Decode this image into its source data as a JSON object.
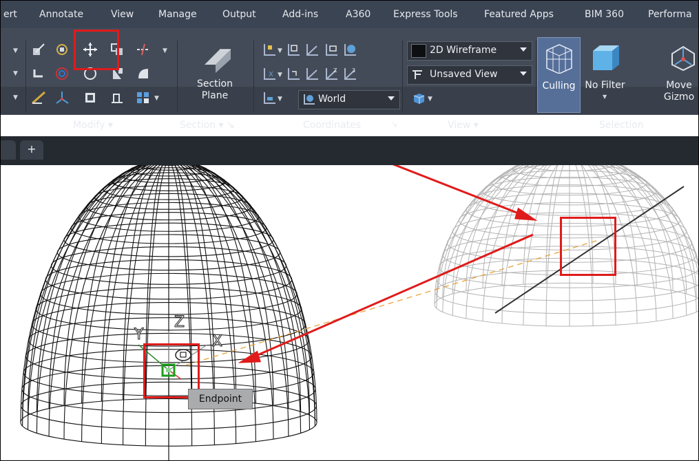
{
  "menu": {
    "items": [
      "ert",
      "Annotate",
      "View",
      "Manage",
      "Output",
      "Add-ins",
      "A360",
      "Express Tools",
      "Featured Apps",
      "BIM 360",
      "Performa"
    ]
  },
  "ribbon": {
    "panels": {
      "modify": "Modify ▾",
      "section": "Section ▾ ↘",
      "coordinates": "Coordinates",
      "coordinates_launcher": "↘",
      "view": "View ▾",
      "selection": "Selection"
    },
    "section_plane": {
      "line1": "Section",
      "line2": "Plane"
    },
    "visual_style": "2D Wireframe",
    "named_view": "Unsaved View",
    "ucs": "World",
    "selection_buttons": {
      "culling": "Culling",
      "no_filter": "No Filter",
      "move_gizmo_line1": "Move",
      "move_gizmo_line2": "Gizmo"
    }
  },
  "tabs": {
    "new_tab": "+"
  },
  "drawing": {
    "gizmo_axes": {
      "z": "Z",
      "y": "Y",
      "x": "X"
    },
    "snap_tooltip": "Endpoint"
  },
  "colors": {
    "ribbon_bg": "#444b58",
    "menu_bg": "#3b4453",
    "highlight_blue": "#566f99",
    "annotation_red": "#e01b1b",
    "tracking_orange": "#e9a23b"
  }
}
